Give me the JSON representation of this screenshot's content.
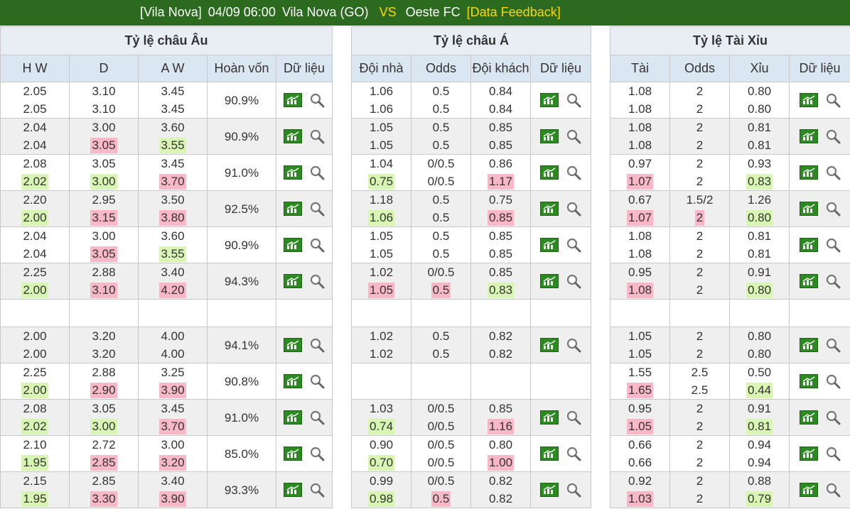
{
  "header": {
    "league": "[Vila Nova]",
    "datetime": "04/09 06:00",
    "home": "Vila Nova (GO)",
    "vs": "VS",
    "away": "Oeste FC",
    "feedback": "[Data Feedback]"
  },
  "tables": [
    {
      "title": "Tỷ lệ châu Âu",
      "columns": [
        "H W",
        "D",
        "A W",
        "Hoàn vốn",
        "Dữ liệu"
      ],
      "rows": [
        {
          "cells": [
            [
              "2.05",
              "2.05"
            ],
            [
              "3.10",
              "3.10"
            ],
            [
              "3.45",
              "3.45"
            ]
          ],
          "hl": [
            [
              "",
              ""
            ],
            [
              "",
              ""
            ],
            [
              "",
              ""
            ]
          ],
          "extra": "90.9%"
        },
        {
          "cells": [
            [
              "2.04",
              "2.04"
            ],
            [
              "3.00",
              "3.05"
            ],
            [
              "3.60",
              "3.55"
            ]
          ],
          "hl": [
            [
              "",
              ""
            ],
            [
              "",
              "up"
            ],
            [
              "",
              "down"
            ]
          ],
          "extra": "90.9%"
        },
        {
          "cells": [
            [
              "2.08",
              "2.02"
            ],
            [
              "3.05",
              "3.00"
            ],
            [
              "3.45",
              "3.70"
            ]
          ],
          "hl": [
            [
              "",
              "down"
            ],
            [
              "",
              "down"
            ],
            [
              "",
              "up"
            ]
          ],
          "extra": "91.0%"
        },
        {
          "cells": [
            [
              "2.20",
              "2.00"
            ],
            [
              "2.95",
              "3.15"
            ],
            [
              "3.50",
              "3.80"
            ]
          ],
          "hl": [
            [
              "",
              "down"
            ],
            [
              "",
              "up"
            ],
            [
              "",
              "up"
            ]
          ],
          "extra": "92.5%"
        },
        {
          "cells": [
            [
              "2.04",
              "2.04"
            ],
            [
              "3.00",
              "3.05"
            ],
            [
              "3.60",
              "3.55"
            ]
          ],
          "hl": [
            [
              "",
              ""
            ],
            [
              "",
              "up"
            ],
            [
              "",
              "down"
            ]
          ],
          "extra": "90.9%"
        },
        {
          "cells": [
            [
              "2.25",
              "2.00"
            ],
            [
              "2.88",
              "3.10"
            ],
            [
              "3.40",
              "4.20"
            ]
          ],
          "hl": [
            [
              "",
              "down"
            ],
            [
              "",
              "up"
            ],
            [
              "",
              "up"
            ]
          ],
          "extra": "94.3%"
        },
        {
          "blank": true
        },
        {
          "cells": [
            [
              "2.00",
              "2.00"
            ],
            [
              "3.20",
              "3.20"
            ],
            [
              "4.00",
              "4.00"
            ]
          ],
          "hl": [
            [
              "",
              ""
            ],
            [
              "",
              ""
            ],
            [
              "",
              ""
            ]
          ],
          "extra": "94.1%"
        },
        {
          "cells": [
            [
              "2.25",
              "2.00"
            ],
            [
              "2.88",
              "2.90"
            ],
            [
              "3.25",
              "3.90"
            ]
          ],
          "hl": [
            [
              "",
              "down"
            ],
            [
              "",
              "up"
            ],
            [
              "",
              "up"
            ]
          ],
          "extra": "90.8%"
        },
        {
          "cells": [
            [
              "2.08",
              "2.02"
            ],
            [
              "3.05",
              "3.00"
            ],
            [
              "3.45",
              "3.70"
            ]
          ],
          "hl": [
            [
              "",
              "down"
            ],
            [
              "",
              "down"
            ],
            [
              "",
              "up"
            ]
          ],
          "extra": "91.0%"
        },
        {
          "cells": [
            [
              "2.10",
              "1.95"
            ],
            [
              "2.72",
              "2.85"
            ],
            [
              "3.00",
              "3.20"
            ]
          ],
          "hl": [
            [
              "",
              "down"
            ],
            [
              "",
              "up"
            ],
            [
              "",
              "up"
            ]
          ],
          "extra": "85.0%"
        },
        {
          "cells": [
            [
              "2.15",
              "1.95"
            ],
            [
              "2.85",
              "3.30"
            ],
            [
              "3.40",
              "3.90"
            ]
          ],
          "hl": [
            [
              "",
              "down"
            ],
            [
              "",
              "up"
            ],
            [
              "",
              "up"
            ]
          ],
          "extra": "93.3%"
        }
      ]
    },
    {
      "title": "Tỷ lệ châu Á",
      "columns": [
        "Đội nhà",
        "Odds",
        "Đội khách",
        "Dữ liệu"
      ],
      "rows": [
        {
          "cells": [
            [
              "1.06",
              "1.06"
            ],
            [
              "0.5",
              "0.5"
            ],
            [
              "0.84",
              "0.84"
            ]
          ],
          "hl": [
            [
              "",
              ""
            ],
            [
              "",
              ""
            ],
            [
              "",
              ""
            ]
          ]
        },
        {
          "cells": [
            [
              "1.05",
              "1.05"
            ],
            [
              "0.5",
              "0.5"
            ],
            [
              "0.85",
              "0.85"
            ]
          ],
          "hl": [
            [
              "",
              ""
            ],
            [
              "",
              ""
            ],
            [
              "",
              ""
            ]
          ]
        },
        {
          "cells": [
            [
              "1.04",
              "0.75"
            ],
            [
              "0/0.5",
              "0/0.5"
            ],
            [
              "0.86",
              "1.17"
            ]
          ],
          "hl": [
            [
              "",
              "down"
            ],
            [
              "",
              ""
            ],
            [
              "",
              "up"
            ]
          ]
        },
        {
          "cells": [
            [
              "1.18",
              "1.06"
            ],
            [
              "0.5",
              "0.5"
            ],
            [
              "0.75",
              "0.85"
            ]
          ],
          "hl": [
            [
              "",
              "down"
            ],
            [
              "",
              ""
            ],
            [
              "",
              "up"
            ]
          ]
        },
        {
          "cells": [
            [
              "1.05",
              "1.05"
            ],
            [
              "0.5",
              "0.5"
            ],
            [
              "0.85",
              "0.85"
            ]
          ],
          "hl": [
            [
              "",
              ""
            ],
            [
              "",
              ""
            ],
            [
              "",
              ""
            ]
          ]
        },
        {
          "cells": [
            [
              "1.02",
              "1.05"
            ],
            [
              "0/0.5",
              "0.5"
            ],
            [
              "0.85",
              "0.83"
            ]
          ],
          "hl": [
            [
              "",
              "up"
            ],
            [
              "",
              "up"
            ],
            [
              "",
              "down"
            ]
          ]
        },
        {
          "blank": true
        },
        {
          "cells": [
            [
              "1.02",
              "1.02"
            ],
            [
              "0.5",
              "0.5"
            ],
            [
              "0.82",
              "0.82"
            ]
          ],
          "hl": [
            [
              "",
              ""
            ],
            [
              "",
              ""
            ],
            [
              "",
              ""
            ]
          ]
        },
        {
          "empty": true
        },
        {
          "cells": [
            [
              "1.03",
              "0.74"
            ],
            [
              "0/0.5",
              "0/0.5"
            ],
            [
              "0.85",
              "1.16"
            ]
          ],
          "hl": [
            [
              "",
              "down"
            ],
            [
              "",
              ""
            ],
            [
              "",
              "up"
            ]
          ]
        },
        {
          "cells": [
            [
              "0.90",
              "0.70"
            ],
            [
              "0/0.5",
              "0/0.5"
            ],
            [
              "0.80",
              "1.00"
            ]
          ],
          "hl": [
            [
              "",
              "down"
            ],
            [
              "",
              ""
            ],
            [
              "",
              "up"
            ]
          ]
        },
        {
          "cells": [
            [
              "0.99",
              "0.98"
            ],
            [
              "0/0.5",
              "0.5"
            ],
            [
              "0.82",
              "0.82"
            ]
          ],
          "hl": [
            [
              "",
              "down"
            ],
            [
              "",
              "up"
            ],
            [
              "",
              ""
            ]
          ]
        }
      ]
    },
    {
      "title": "Tỷ lệ Tài Xỉu",
      "columns": [
        "Tài",
        "Odds",
        "Xỉu",
        "Dữ liệu"
      ],
      "rows": [
        {
          "cells": [
            [
              "1.08",
              "1.08"
            ],
            [
              "2",
              "2"
            ],
            [
              "0.80",
              "0.80"
            ]
          ],
          "hl": [
            [
              "",
              ""
            ],
            [
              "",
              ""
            ],
            [
              "",
              ""
            ]
          ]
        },
        {
          "cells": [
            [
              "1.08",
              "1.08"
            ],
            [
              "2",
              "2"
            ],
            [
              "0.81",
              "0.81"
            ]
          ],
          "hl": [
            [
              "",
              ""
            ],
            [
              "",
              ""
            ],
            [
              "",
              ""
            ]
          ]
        },
        {
          "cells": [
            [
              "0.97",
              "1.07"
            ],
            [
              "2",
              "2"
            ],
            [
              "0.93",
              "0.83"
            ]
          ],
          "hl": [
            [
              "",
              "up"
            ],
            [
              "",
              ""
            ],
            [
              "",
              "down"
            ]
          ]
        },
        {
          "cells": [
            [
              "0.67",
              "1.07"
            ],
            [
              "1.5/2",
              "2"
            ],
            [
              "1.26",
              "0.80"
            ]
          ],
          "hl": [
            [
              "",
              "up"
            ],
            [
              "",
              "up"
            ],
            [
              "",
              "down"
            ]
          ]
        },
        {
          "cells": [
            [
              "1.08",
              "1.08"
            ],
            [
              "2",
              "2"
            ],
            [
              "0.81",
              "0.81"
            ]
          ],
          "hl": [
            [
              "",
              ""
            ],
            [
              "",
              ""
            ],
            [
              "",
              ""
            ]
          ]
        },
        {
          "cells": [
            [
              "0.95",
              "1.08"
            ],
            [
              "2",
              "2"
            ],
            [
              "0.91",
              "0.80"
            ]
          ],
          "hl": [
            [
              "",
              "up"
            ],
            [
              "",
              ""
            ],
            [
              "",
              "down"
            ]
          ]
        },
        {
          "blank": true
        },
        {
          "cells": [
            [
              "1.05",
              "1.05"
            ],
            [
              "2",
              "2"
            ],
            [
              "0.80",
              "0.80"
            ]
          ],
          "hl": [
            [
              "",
              ""
            ],
            [
              "",
              ""
            ],
            [
              "",
              ""
            ]
          ]
        },
        {
          "cells": [
            [
              "1.55",
              "1.65"
            ],
            [
              "2.5",
              "2.5"
            ],
            [
              "0.50",
              "0.44"
            ]
          ],
          "hl": [
            [
              "",
              "up"
            ],
            [
              "",
              ""
            ],
            [
              "",
              "down"
            ]
          ]
        },
        {
          "cells": [
            [
              "0.95",
              "1.05"
            ],
            [
              "2",
              "2"
            ],
            [
              "0.91",
              "0.81"
            ]
          ],
          "hl": [
            [
              "",
              "up"
            ],
            [
              "",
              ""
            ],
            [
              "",
              "down"
            ]
          ]
        },
        {
          "cells": [
            [
              "0.66",
              "0.66"
            ],
            [
              "2",
              "2"
            ],
            [
              "0.94",
              "0.94"
            ]
          ],
          "hl": [
            [
              "",
              ""
            ],
            [
              "",
              ""
            ],
            [
              "",
              ""
            ]
          ]
        },
        {
          "cells": [
            [
              "0.92",
              "1.03"
            ],
            [
              "2",
              "2"
            ],
            [
              "0.88",
              "0.79"
            ]
          ],
          "hl": [
            [
              "",
              "up"
            ],
            [
              "",
              ""
            ],
            [
              "",
              "down"
            ]
          ]
        }
      ]
    }
  ],
  "colors": {
    "header_bar": "#2c6a1f",
    "accent": "#ffd700",
    "rise": "#f8b8c8",
    "fall": "#d8f5b4",
    "chart_icon": "#2d8a22"
  },
  "icons": {
    "chart": "bar-chart-icon",
    "detail": "magnifier-icon"
  }
}
